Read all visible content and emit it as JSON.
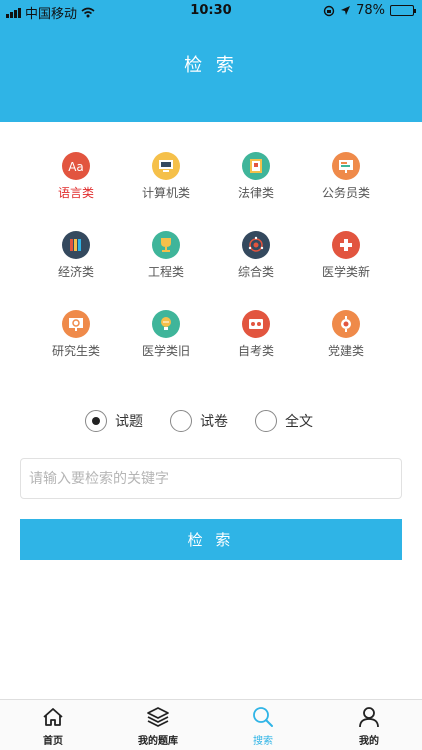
{
  "status_bar": {
    "carrier": "中国移动",
    "time": "10:30",
    "battery": "78%",
    "battery_level": 0.78
  },
  "header": {
    "title": "检 索"
  },
  "categories": [
    {
      "label": "语言类",
      "icon": "language-icon",
      "color": "#e2553f",
      "active": true
    },
    {
      "label": "计算机类",
      "icon": "computer-icon",
      "color": "#f5c04a"
    },
    {
      "label": "法律类",
      "icon": "law-book-icon",
      "color": "#3fb59a"
    },
    {
      "label": "公务员类",
      "icon": "civil-servant-board-icon",
      "color": "#ef8a4a"
    },
    {
      "label": "经济类",
      "icon": "economics-books-icon",
      "color": "#34495e"
    },
    {
      "label": "工程类",
      "icon": "engineering-trophy-icon",
      "color": "#3fb59a"
    },
    {
      "label": "综合类",
      "icon": "comprehensive-globe-icon",
      "color": "#34495e"
    },
    {
      "label": "医学类新",
      "icon": "medical-cross-icon",
      "color": "#e2553f"
    },
    {
      "label": "研究生类",
      "icon": "graduate-research-icon",
      "color": "#ef8a4a"
    },
    {
      "label": "医学类旧",
      "icon": "medical-bulb-icon",
      "color": "#3fb59a"
    },
    {
      "label": "自考类",
      "icon": "self-study-icon",
      "color": "#e2553f"
    },
    {
      "label": "党建类",
      "icon": "party-building-icon",
      "color": "#ef8a4a"
    }
  ],
  "search_scope": {
    "options": [
      "试题",
      "试卷",
      "全文"
    ],
    "selected": "试题"
  },
  "search": {
    "placeholder": "请输入要检索的关键字",
    "value": "",
    "button_label": "检 索"
  },
  "tabbar": [
    {
      "label": "首页",
      "icon": "home-icon"
    },
    {
      "label": "我的题库",
      "icon": "layers-icon"
    },
    {
      "label": "搜索",
      "icon": "search-icon",
      "active": true
    },
    {
      "label": "我的",
      "icon": "user-icon"
    }
  ],
  "colors": {
    "accent": "#2fb4e6",
    "active_category": "#e02a2a"
  }
}
